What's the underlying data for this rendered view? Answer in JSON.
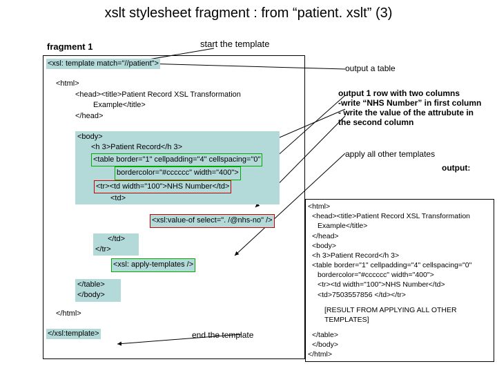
{
  "title": "xslt stylesheet fragment : from “patient. xslt” (3)",
  "labels": {
    "fragment": "fragment 1",
    "start": "start the template",
    "outputTable": "output a table",
    "row1a": "output 1 row with two columns",
    "row1b": "-write “NHS Number” in first column",
    "row1c": "- write the value of the attrubute in the second column",
    "applyAll": "apply all other templates",
    "output": "output:",
    "end": "end the template"
  },
  "code": {
    "tplOpen": "<xsl: template match=\"//patient\">",
    "htmlOpen": "<html>",
    "head1": "<head><title>Patient Record XSL Transformation",
    "head2": "Example</title>",
    "head3": "</head>",
    "bodyOpen": "<body>",
    "h3": "<h 3>Patient Record</h 3>",
    "table1": "<table border=\"1\" cellpadding=\"4\" cellspacing=\"0\"",
    "table2": "bordercolor=\"#cccccc\" width=\"400\">",
    "tr1": "<tr><td width=\"100\">NHS Number</td>",
    "tdOpen": "<td>",
    "valueOf": "<xsl:value-of select=\". /@nhs-no\" />",
    "tdClose": "</td>",
    "trClose": "</tr>",
    "applyTpl": "<xsl: apply-templates />",
    "tableClose": "</table>",
    "bodyClose": "</body>",
    "htmlClose": "</html>",
    "tplClose": "</xsl:template>"
  },
  "out": {
    "l1": "<html>",
    "l2": "<head><title>Patient Record XSL Transformation",
    "l3": "Example</title>",
    "l4": "</head>",
    "l5": "<body>",
    "l6": "<h 3>Patient Record</h 3>",
    "l7": "<table border=\"1\" cellpadding=\"4\" cellspacing=\"0\"",
    "l8": "bordercolor=\"#cccccc\" width=\"400\">",
    "l9": "<tr><td width=\"100\">NHS Number</td>",
    "l10": "<td>7503557856 </td></tr>",
    "result": "[RESULT FROM APPLYING ALL OTHER TEMPLATES]",
    "l11": "</table>",
    "l12": "</body>",
    "l13": "</html>"
  }
}
